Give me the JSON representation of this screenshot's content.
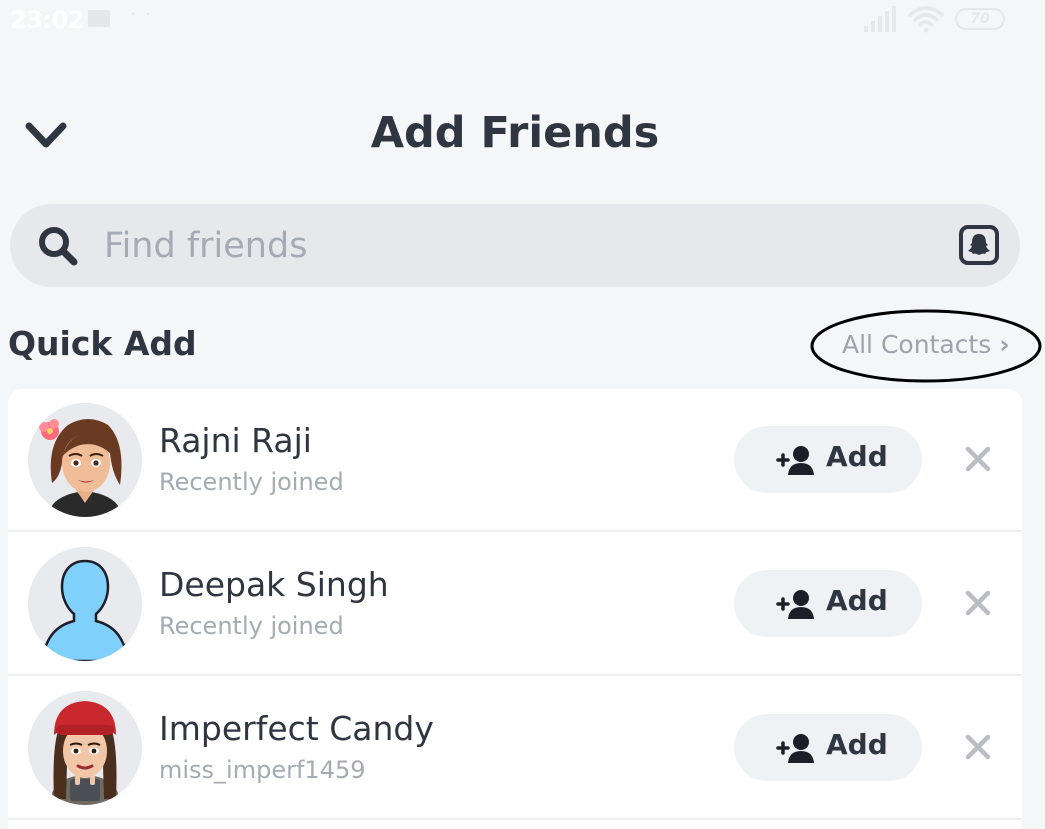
{
  "status_bar": {
    "time": "23:02",
    "dots": "· ·",
    "battery": "70",
    "icons": [
      "mail-icon",
      "signal-icon",
      "wifi-icon",
      "battery-icon"
    ]
  },
  "header": {
    "title": "Add Friends",
    "back_icon": "chevron-down-icon"
  },
  "search": {
    "placeholder": "Find friends",
    "icon": "search-icon",
    "snapcode_icon": "snapcode-icon"
  },
  "quick_add": {
    "title": "Quick Add",
    "all_contacts_label": "All Contacts",
    "all_contacts_chevron": "›",
    "items": [
      {
        "name": "Rajni Raji",
        "subtext": "Recently joined",
        "add_label": "Add",
        "avatar": "bitmoji-avatar"
      },
      {
        "name": "Deepak Singh",
        "subtext": "Recently joined",
        "add_label": "Add",
        "avatar": "default-silhouette-avatar"
      },
      {
        "name": "Imperfect Candy",
        "subtext": "miss_imperf1459",
        "add_label": "Add",
        "avatar": "bitmoji-avatar"
      }
    ]
  },
  "colors": {
    "background": "#f5f6f8",
    "text_primary": "#2f3541",
    "text_secondary": "#a6aab2",
    "search_bg": "#e6e8eb",
    "button_bg": "#f0f1f4",
    "silhouette_blue": "#7fd0fb"
  }
}
